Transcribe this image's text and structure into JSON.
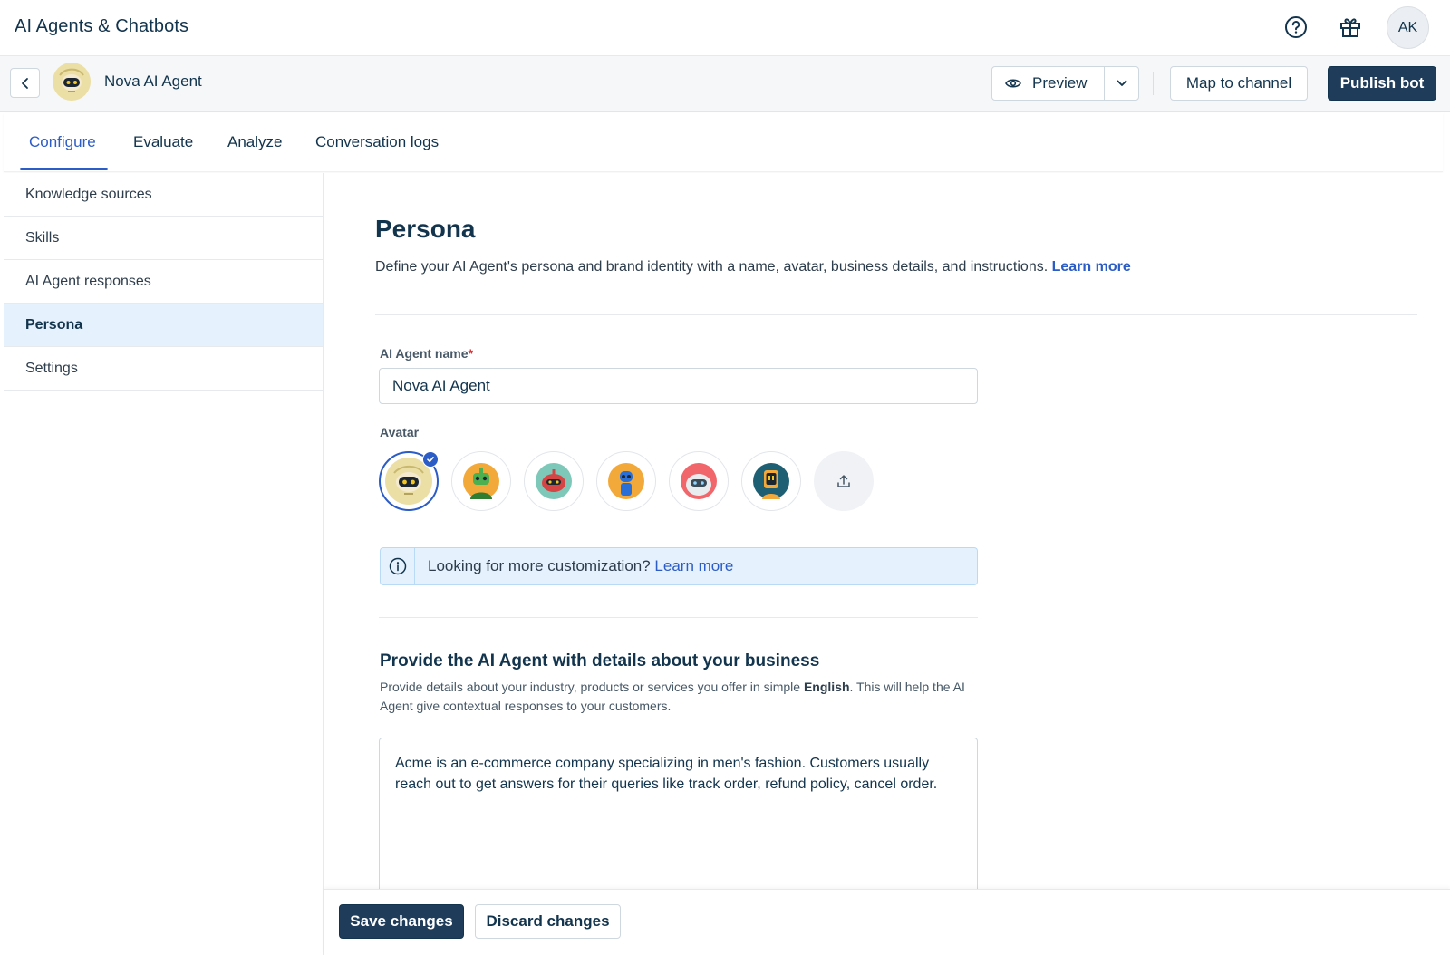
{
  "app": {
    "title": "AI Agents & Chatbots",
    "user_initials": "AK"
  },
  "bot": {
    "name": "Nova AI Agent",
    "preview_label": "Preview",
    "map_label": "Map to channel",
    "publish_label": "Publish bot"
  },
  "tabs": [
    {
      "label": "Configure",
      "active": true
    },
    {
      "label": "Evaluate",
      "active": false
    },
    {
      "label": "Analyze",
      "active": false
    },
    {
      "label": "Conversation logs",
      "active": false
    }
  ],
  "sidebar": {
    "items": [
      {
        "label": "Knowledge sources",
        "active": false
      },
      {
        "label": "Skills",
        "active": false
      },
      {
        "label": "AI Agent responses",
        "active": false
      },
      {
        "label": "Persona",
        "active": true
      },
      {
        "label": "Settings",
        "active": false
      }
    ]
  },
  "persona": {
    "title": "Persona",
    "description": "Define your AI Agent's persona and brand identity with a name, avatar, business details, and instructions.",
    "learn_more": "Learn more",
    "name_label": "AI Agent name",
    "name_required_mark": "*",
    "name_value": "Nova AI Agent",
    "avatar_label": "Avatar",
    "avatars": [
      {
        "icon": "nova-robot-avatar-icon",
        "bg": "#ecdfa5",
        "selected": true
      },
      {
        "icon": "green-robot-avatar-icon",
        "bg": "#f3a93a",
        "selected": false
      },
      {
        "icon": "red-robot-avatar-icon",
        "bg": "#7dc8b8",
        "selected": false
      },
      {
        "icon": "blue-robot-avatar-icon",
        "bg": "#f3a93a",
        "selected": false
      },
      {
        "icon": "white-robot-avatar-icon",
        "bg": "#f1666a",
        "selected": false
      },
      {
        "icon": "screen-robot-avatar-icon",
        "bg": "#1e5f74",
        "selected": false
      }
    ],
    "info_text": "Looking for more customization?",
    "info_link": "Learn more",
    "business_title": "Provide the AI Agent with details about your business",
    "business_desc_1": "Provide details about your industry, products or services you offer in simple ",
    "business_desc_bold": "English",
    "business_desc_2": ". This will help the AI Agent give contextual responses to your customers.",
    "business_value": "Acme is an e-commerce company specializing in men's fashion. Customers usually reach out to get answers for their queries like track order, refund policy, cancel order."
  },
  "footer": {
    "save_label": "Save changes",
    "discard_label": "Discard changes"
  },
  "colors": {
    "primary_dark": "#1f3d5a",
    "link_blue": "#2c5cc5",
    "selected_bg": "#e5f2fd"
  }
}
